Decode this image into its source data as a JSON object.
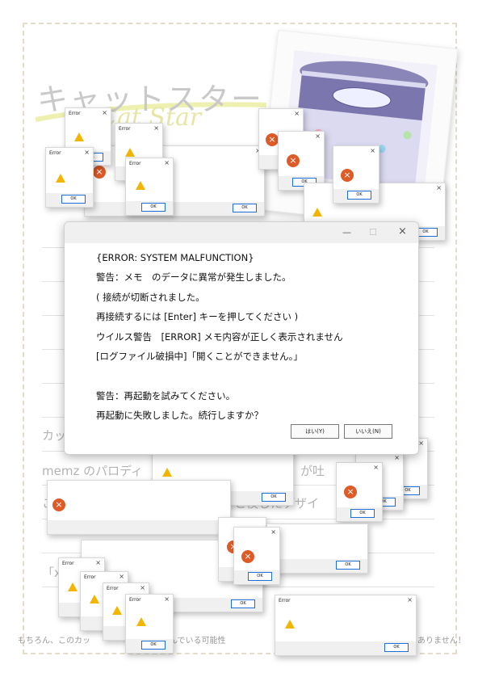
{
  "background": {
    "title_jp": "キャットスター",
    "title_en": "Cat Star",
    "rows": [
      "カッ",
      "memz のパロディ",
      "が吐",
      "こ",
      "と模したデザイ",
      "「x"
    ],
    "footer_left": "もちろん、このカッ",
    "footer_mid": "スを含んでいる可能性",
    "footer_right": "ありません！"
  },
  "popup": {
    "title": "Error",
    "close": "×",
    "ok": "OK"
  },
  "main_dialog": {
    "controls": {
      "minimize": "—",
      "maximize": "☐",
      "close": "×"
    },
    "lines": [
      "{ERROR: SYSTEM MALFUNCTION}",
      "警告：メモ　のデータに異常が発生しました。",
      "( 接続が切断されました。",
      "再接続するには [Enter] キーを押してください )",
      "ウイルス警告　[ERROR] メモ内容が正しく表示されません",
      "[ログファイル破損中]「開くことができません。」",
      "",
      "警告：再起動を試みてください。",
      "再起動に失敗しました。続行しますか？"
    ],
    "yes_button": "はい(Y)",
    "no_button": "いいえ(N)"
  },
  "colors": {
    "ok_border": "#1b6fd6",
    "warning": "#f2b500",
    "error": "#de5b28"
  }
}
